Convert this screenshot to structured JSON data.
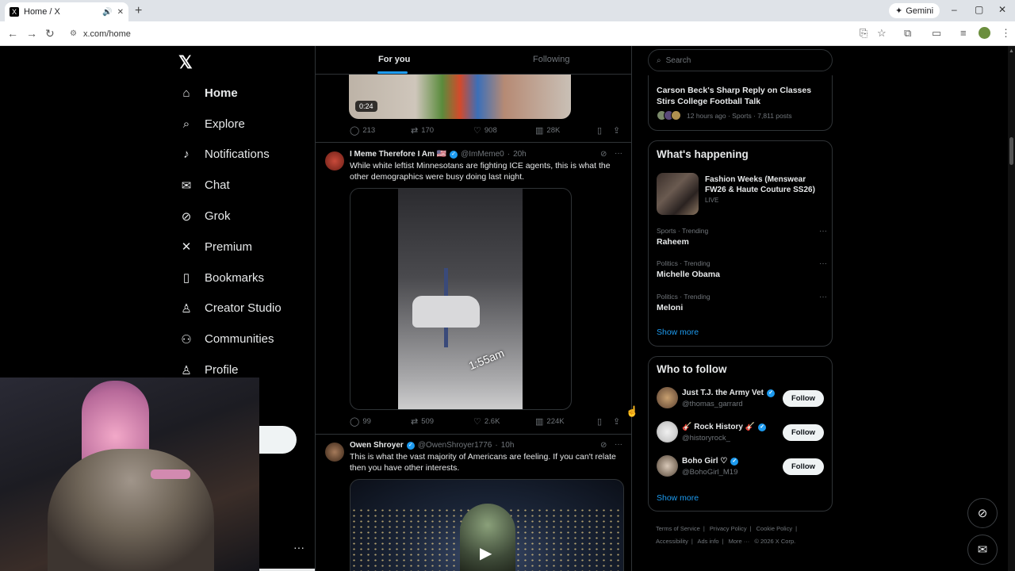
{
  "browser": {
    "tab_title": "Home / X",
    "tab_favicon": "X",
    "new_tab": "+",
    "gemini_label": "Gemini",
    "url": "x.com/home",
    "window_controls": [
      "–",
      "▢",
      "✕"
    ]
  },
  "nav": {
    "logo": "𝕏",
    "items": [
      {
        "label": "Home",
        "icon": "home-icon",
        "glyph": "⌂"
      },
      {
        "label": "Explore",
        "icon": "search-icon",
        "glyph": "⌕"
      },
      {
        "label": "Notifications",
        "icon": "bell-icon",
        "glyph": "♪"
      },
      {
        "label": "Chat",
        "icon": "mail-icon",
        "glyph": "✉"
      },
      {
        "label": "Grok",
        "icon": "grok-icon",
        "glyph": "⊘"
      },
      {
        "label": "Premium",
        "icon": "x-icon",
        "glyph": "✕"
      },
      {
        "label": "Bookmarks",
        "icon": "bookmark-icon",
        "glyph": "▯"
      },
      {
        "label": "Creator Studio",
        "icon": "creator-studio-icon",
        "glyph": "♙"
      },
      {
        "label": "Communities",
        "icon": "communities-icon",
        "glyph": "⚇"
      },
      {
        "label": "Profile",
        "icon": "profile-icon",
        "glyph": "♙"
      }
    ],
    "more_dots": "···"
  },
  "feed": {
    "tabs": [
      "For you",
      "Following"
    ],
    "post1": {
      "duration": "0:24",
      "replies": "213",
      "reposts": "170",
      "likes": "908",
      "views": "28K"
    },
    "post2": {
      "name": "I Meme Therefore I Am 🇺🇸",
      "handle": "@ImMeme0",
      "time": "20h",
      "text": "While white leftist Minnesotans are fighting ICE agents, this is what the other demographics were busy doing last night.",
      "video_stamp": "1:55am",
      "replies": "99",
      "reposts": "509",
      "likes": "2.6K",
      "views": "224K"
    },
    "post3": {
      "name": "Owen Shroyer",
      "handle": "@OwenShroyer1776",
      "time": "10h",
      "text": "This is what the vast majority of Americans are feeling. If you can't relate then you have other interests."
    }
  },
  "sidebar": {
    "search_placeholder": "Search",
    "top_trend": {
      "title": "Carson Beck's Sharp Reply on Classes Stirs College Football Talk",
      "meta": "12 hours ago · Sports · 7,811 posts"
    },
    "happening": {
      "title": "What's happening",
      "featured_title": "Fashion Weeks (Menswear FW26 & Haute Couture SS26)",
      "featured_status": "LIVE",
      "trends": [
        {
          "category": "Sports · Trending",
          "name": "Raheem"
        },
        {
          "category": "Politics · Trending",
          "name": "Michelle Obama"
        },
        {
          "category": "Politics · Trending",
          "name": "Meloni"
        }
      ],
      "show_more": "Show more"
    },
    "who_to_follow": {
      "title": "Who to follow",
      "accounts": [
        {
          "name": "Just T.J. the Army Vet",
          "handle": "@thomas_garrard",
          "button": "Follow"
        },
        {
          "name": "🎸 Rock History 🎸",
          "handle": "@historyrock_",
          "button": "Follow"
        },
        {
          "name": "Boho Girl ♡",
          "handle": "@BohoGirl_M19",
          "button": "Follow"
        }
      ],
      "show_more": "Show more"
    },
    "footer": {
      "links": [
        "Terms of Service",
        "|",
        "Privacy Policy",
        "|",
        "Cookie Policy",
        "|",
        "Accessibility",
        "|",
        "Ads info",
        "|",
        "More ···",
        "© 2026 X Corp."
      ]
    }
  },
  "colors": {
    "accent": "#1d9bf0",
    "background": "#000000",
    "border": "#2f3336"
  }
}
